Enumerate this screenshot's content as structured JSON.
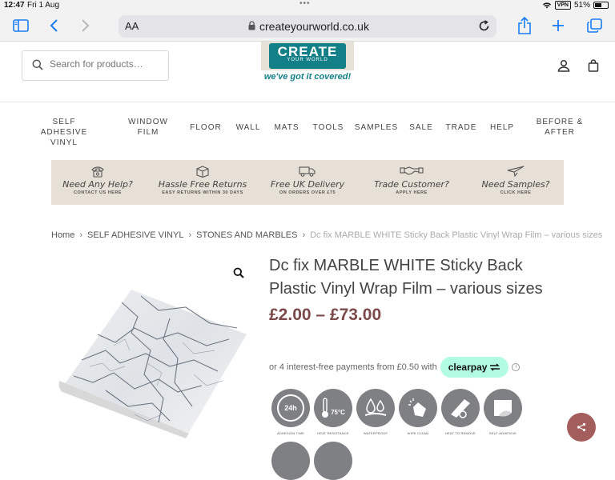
{
  "status_bar": {
    "time": "12:47",
    "date": "Fri 1 Aug",
    "vpn": "VPN",
    "battery": "51%"
  },
  "browser": {
    "aa_label": "AA",
    "url": "createyourworld.co.uk"
  },
  "header": {
    "search_placeholder": "Search for products…",
    "logo_main": "CREATE",
    "logo_sub": "YOUR WORLD",
    "logo_tagline": "we've got it covered!"
  },
  "nav": {
    "items": [
      {
        "label_line1": "SELF ADHESIVE",
        "label_line2": "VINYL"
      },
      {
        "label_line1": "WINDOW",
        "label_line2": "FILM"
      },
      {
        "label_line1": "FLOOR",
        "label_line2": ""
      },
      {
        "label_line1": "WALL",
        "label_line2": ""
      },
      {
        "label_line1": "MATS",
        "label_line2": ""
      },
      {
        "label_line1": "TOOLS",
        "label_line2": ""
      },
      {
        "label_line1": "SAMPLES",
        "label_line2": ""
      },
      {
        "label_line1": "SALE",
        "label_line2": ""
      },
      {
        "label_line1": "TRADE",
        "label_line2": ""
      },
      {
        "label_line1": "HELP",
        "label_line2": ""
      },
      {
        "label_line1": "BEFORE &",
        "label_line2": "AFTER"
      }
    ]
  },
  "promo": {
    "items": [
      {
        "icon": "phone-icon",
        "title": "Need Any Help?",
        "subtitle": "CONTACT US HERE"
      },
      {
        "icon": "box-icon",
        "title": "Hassle Free Returns",
        "subtitle": "EASY RETURNS WITHIN 30 DAYS"
      },
      {
        "icon": "truck-icon",
        "title": "Free UK Delivery",
        "subtitle": "ON ORDERS OVER £75"
      },
      {
        "icon": "handshake-icon",
        "title": "Trade Customer?",
        "subtitle": "APPLY HERE"
      },
      {
        "icon": "paper-plane-icon",
        "title": "Need Samples?",
        "subtitle": "CLICK HERE"
      }
    ]
  },
  "breadcrumb": {
    "items": [
      "Home",
      "SELF ADHESIVE VINYL",
      "STONES AND MARBLES"
    ],
    "current": "Dc fix MARBLE WHITE Sticky Back Plastic Vinyl Wrap Film – various sizes"
  },
  "product": {
    "title_line1": "Dc fix MARBLE WHITE Sticky Back",
    "title_line2": "Plastic Vinyl Wrap Film – various sizes",
    "price": "£2.00 – £73.00",
    "clearpay_text": "or 4 interest-free payments from £0.50 with",
    "clearpay_brand": "clearpay",
    "features": [
      {
        "icon": "24h-adhesion-icon",
        "glyph": "24h",
        "label": "ADHESION TIME"
      },
      {
        "icon": "thermometer-icon",
        "glyph": "75°C",
        "label": "HEAT RESISTANCE"
      },
      {
        "icon": "water-drops-icon",
        "glyph": "",
        "label": "WATERPROOF"
      },
      {
        "icon": "wipe-hand-icon",
        "glyph": "",
        "label": "WIPE CLEAN"
      },
      {
        "icon": "hairdryer-icon",
        "glyph": "",
        "label": "HEAT TO REMOVE"
      },
      {
        "icon": "peel-icon",
        "glyph": "",
        "label": "SELF-ADHESIVE"
      }
    ]
  },
  "colors": {
    "brand_teal": "#137f86",
    "price": "#7a4a4a",
    "clearpay": "#b2fce4",
    "share_fab": "#a35d5d",
    "ios_blue": "#1a7cf5"
  }
}
